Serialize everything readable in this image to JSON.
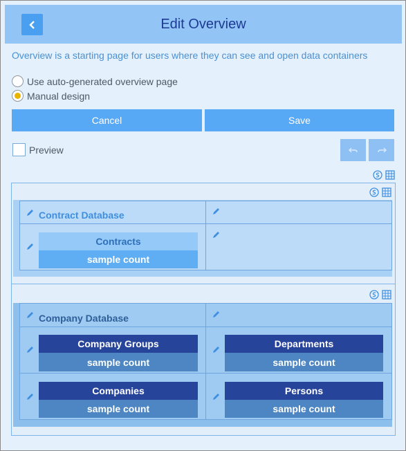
{
  "header": {
    "title": "Edit Overview"
  },
  "description": "Overview is a starting page for users where they can see and open data containers",
  "options": [
    {
      "label": "Use auto-generated overview page",
      "selected": false
    },
    {
      "label": "Manual design",
      "selected": true
    }
  ],
  "actions": {
    "cancel": "Cancel",
    "save": "Save"
  },
  "preview": {
    "label": "Preview",
    "checked": false
  },
  "colors": {
    "accent": "#57a9f5",
    "title": "#1d3a94",
    "radio_selected": "#e8b400",
    "dark_card": "#27449b"
  },
  "sections": [
    {
      "title": "Contract Database",
      "cards": [
        {
          "name": "Contracts",
          "count": "sample count"
        }
      ]
    },
    {
      "title": "Company Database",
      "cards": [
        {
          "name": "Company Groups",
          "count": "sample count"
        },
        {
          "name": "Departments",
          "count": "sample count"
        },
        {
          "name": "Companies",
          "count": "sample count"
        },
        {
          "name": "Persons",
          "count": "sample count"
        }
      ]
    }
  ]
}
